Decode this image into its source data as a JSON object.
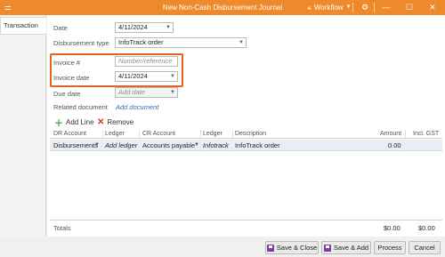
{
  "window": {
    "title": "New Non-Cash Disbursement Journal",
    "workflow_label": "Workflow",
    "icons": {
      "app": "app-menu-icon",
      "workflow": "workflow-icon",
      "settings": "gear-icon",
      "minimize": "minimize-icon",
      "maximize": "maximize-icon",
      "close": "close-icon"
    }
  },
  "tabs": [
    {
      "label": "Transaction"
    }
  ],
  "form": {
    "date": {
      "label": "Date",
      "value": "4/11/2024"
    },
    "disbursement_type": {
      "label": "Disbursement type",
      "value": "InfoTrack order"
    },
    "invoice_no": {
      "label": "Invoice #",
      "placeholder": "Number/reference"
    },
    "invoice_date": {
      "label": "Invoice date",
      "value": "4/11/2024"
    },
    "due_date": {
      "label": "Due date",
      "placeholder": "Add date"
    },
    "related_document": {
      "label": "Related document",
      "link": "Add document"
    }
  },
  "lines_toolbar": {
    "add_label": "Add Line",
    "remove_label": "Remove"
  },
  "grid": {
    "headers": [
      "DR Account",
      "Ledger",
      "CR Account",
      "Ledger",
      "Description",
      "Amount",
      "Incl. GST"
    ],
    "rows": [
      {
        "dr_account": "Disbursements",
        "dr_ledger": "Add ledger",
        "cr_account": "Accounts payable",
        "cr_ledger": "Infotrack",
        "description": "InfoTrack order",
        "amount": "0.00",
        "incl_gst": ""
      }
    ]
  },
  "totals": {
    "label": "Totals",
    "amount": "$0.00",
    "incl_gst": "$0.00"
  },
  "footer": {
    "save_close": "Save & Close",
    "save_add": "Save & Add",
    "process": "Process",
    "cancel": "Cancel"
  },
  "colors": {
    "titlebar": "#ef8a2c",
    "highlight": "#e8621f",
    "link": "#2f6fc4",
    "selected_row": "#e9eef6"
  }
}
